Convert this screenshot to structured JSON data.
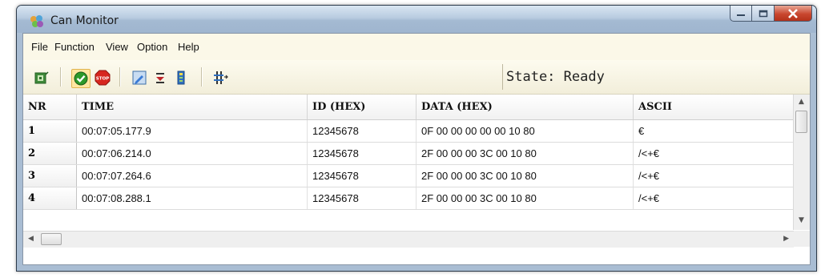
{
  "window": {
    "title": "Can Monitor"
  },
  "menu": [
    "File",
    "Function",
    "View",
    "Option",
    "Help"
  ],
  "toolbar": {
    "icons": [
      "connect-icon",
      "start-icon",
      "stop-icon",
      "edit-icon",
      "filter-icon",
      "log-icon",
      "columns-icon"
    ],
    "state": "State: Ready"
  },
  "table": {
    "headers": [
      "NR",
      "TIME",
      "ID (HEX)",
      "DATA (HEX)",
      "ASCII"
    ],
    "rows": [
      {
        "nr": "1",
        "time": "00:07:05.177.9",
        "id": "12345678",
        "data": "0F 00 00 00 00 00 10 80",
        "ascii": "€"
      },
      {
        "nr": "2",
        "time": "00:07:06.214.0",
        "id": "12345678",
        "data": "2F 00 00 00 3C 00 10 80",
        "ascii": "/<+€"
      },
      {
        "nr": "3",
        "time": "00:07:07.264.6",
        "id": "12345678",
        "data": "2F 00 00 00 3C 00 10 80",
        "ascii": "/<+€"
      },
      {
        "nr": "4",
        "time": "00:07:08.288.1",
        "id": "12345678",
        "data": "2F 00 00 00 3C 00 10 80",
        "ascii": "/<+€"
      }
    ]
  },
  "colors": {
    "accent": "#a9bdd3",
    "close": "#c9472f",
    "menubar": "#fbf8e8"
  }
}
